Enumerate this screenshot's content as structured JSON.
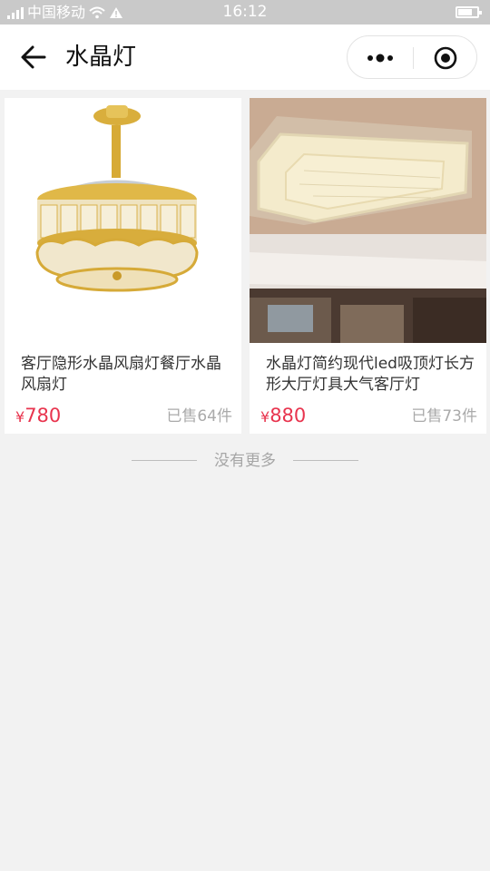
{
  "status_bar": {
    "carrier": "中国移动",
    "time": "16:12"
  },
  "header": {
    "title": "水晶灯"
  },
  "products": [
    {
      "title": "客厅隐形水晶风扇灯餐厅水晶风扇灯",
      "currency": "¥",
      "price": "780",
      "sold": "已售64件"
    },
    {
      "title": "水晶灯简约现代led吸顶灯长方形大厅灯具大气客厅灯",
      "currency": "¥",
      "price": "880",
      "sold": "已售73件"
    }
  ],
  "footer": {
    "no_more": "没有更多"
  },
  "colors": {
    "price": "#e8344e",
    "status_bar": "#c9c9c9",
    "background": "#f2f2f2"
  }
}
